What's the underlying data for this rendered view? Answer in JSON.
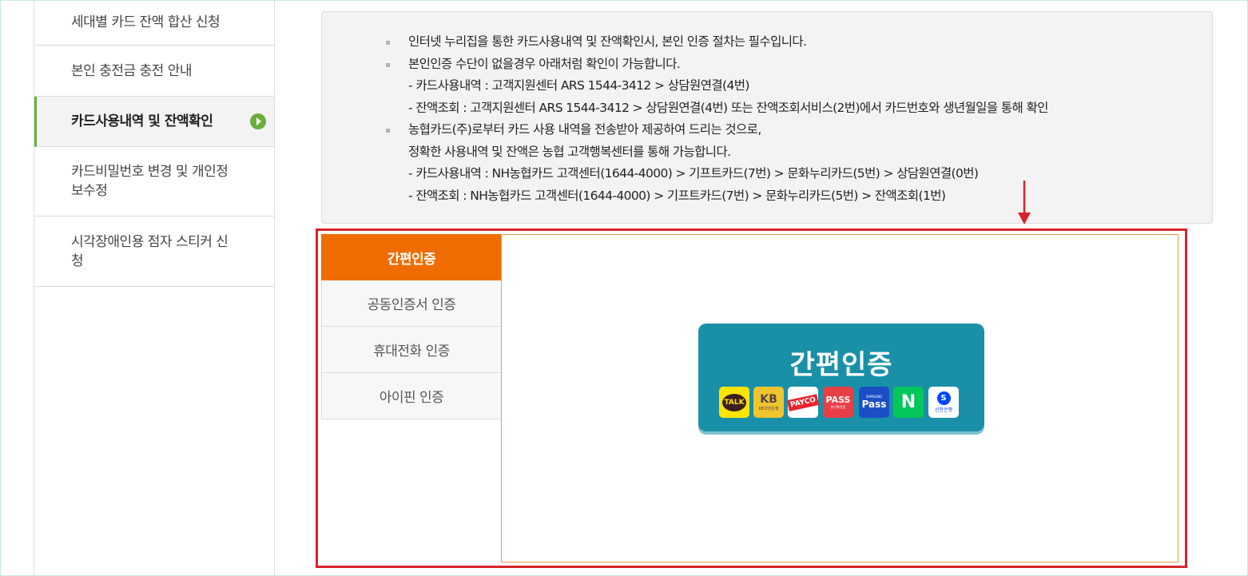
{
  "sidebar": {
    "items": [
      {
        "label": "세대별 카드 잔액 합산 신청"
      },
      {
        "label": "본인 충전금 충전 안내"
      },
      {
        "label": "카드사용내역 및 잔액확인"
      },
      {
        "label": "카드비밀번호 변경 및 개인정보수정"
      },
      {
        "label": "시각장애인용 점자 스티커 신청"
      }
    ],
    "active_index": 2,
    "accent_color": "#6aae3b"
  },
  "notice": {
    "items": [
      {
        "lines": [
          "인터넷 누리집을 통한 카드사용내역 및 잔액확인시, 본인 인증 절차는 필수입니다."
        ]
      },
      {
        "lines": [
          "본인인증 수단이 없을경우 아래처럼 확인이 가능합니다.",
          "- 카드사용내역 : 고객지원센터 ARS 1544-3412 > 상담원연결(4번)",
          "- 잔액조회 : 고객지원센터 ARS 1544-3412 > 상담원연결(4번) 또는 잔액조회서비스(2번)에서 카드번호와 생년월일을 통해 확인"
        ]
      },
      {
        "lines": [
          "농협카드(주)로부터 카드 사용 내역을 전송받아 제공하여 드리는 것으로,",
          "정확한 사용내역 및 잔액은 농협 고객행복센터를 통해 가능합니다.",
          "- 카드사용내역 : NH농협카드 고객센터(1644-4000) > 기프트카드(7번) > 문화누리카드(5번) > 상담원연결(0번)",
          "- 잔액조회 : NH농협카드 고객센터(1644-4000) > 기프트카드(7번) > 문화누리카드(5번) > 잔액조회(1번)"
        ]
      }
    ]
  },
  "auth": {
    "tabs": [
      {
        "label": "간편인증"
      },
      {
        "label": "공동인증서 인증"
      },
      {
        "label": "휴대전화 인증"
      },
      {
        "label": "아이핀 인증"
      }
    ],
    "active_index": 0,
    "active_color": "#ef6c00",
    "easy": {
      "title": "간편인증",
      "card_color": "#1990a8",
      "providers": {
        "kakao": "TALK",
        "kb": "KB",
        "kb_sub": "KB국민은행",
        "payco": "PAYCO",
        "pass": "PASS",
        "pass_sub": "본인확인앱",
        "spass_top": "SAMSUNG",
        "spass": "Pass",
        "naver": "N",
        "shinhan_mark": "S",
        "shinhan": "신한은행"
      }
    }
  },
  "annotation": {
    "color": "#d9232a"
  }
}
